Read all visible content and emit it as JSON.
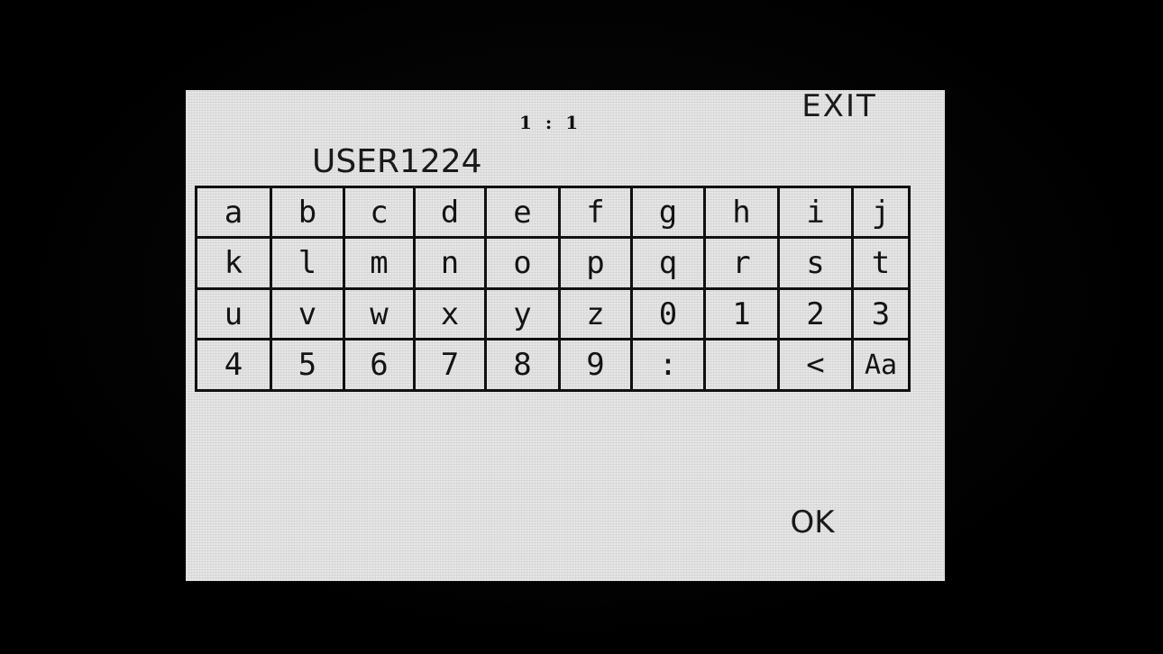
{
  "header": {
    "exit_label": "EXIT",
    "cursor_position": "1 : 1",
    "name_value": "USER1224"
  },
  "keyboard": {
    "rows": [
      [
        "a",
        "b",
        "c",
        "d",
        "e",
        "f",
        "g",
        "h",
        "i",
        "j"
      ],
      [
        "k",
        "l",
        "m",
        "n",
        "o",
        "p",
        "q",
        "r",
        "s",
        "t"
      ],
      [
        "u",
        "v",
        "w",
        "x",
        "y",
        "z",
        "0",
        "1",
        "2",
        "3"
      ],
      [
        "4",
        "5",
        "6",
        "7",
        "8",
        "9",
        ":",
        " ",
        "<",
        "Aa"
      ]
    ],
    "key_names": [
      [
        "key-a",
        "key-b",
        "key-c",
        "key-d",
        "key-e",
        "key-f",
        "key-g",
        "key-h",
        "key-i",
        "key-j"
      ],
      [
        "key-k",
        "key-l",
        "key-m",
        "key-n",
        "key-o",
        "key-p",
        "key-q",
        "key-r",
        "key-s",
        "key-t"
      ],
      [
        "key-u",
        "key-v",
        "key-w",
        "key-x",
        "key-y",
        "key-z",
        "key-0",
        "key-1",
        "key-2",
        "key-3"
      ],
      [
        "key-4",
        "key-5",
        "key-6",
        "key-7",
        "key-8",
        "key-9",
        "key-colon",
        "key-space",
        "backspace-key",
        "case-toggle-key"
      ]
    ]
  },
  "footer": {
    "ok_label": "OK"
  },
  "colors": {
    "screen_bg": "#e6e6e6",
    "bezel": "#000000",
    "text": "#141414"
  }
}
